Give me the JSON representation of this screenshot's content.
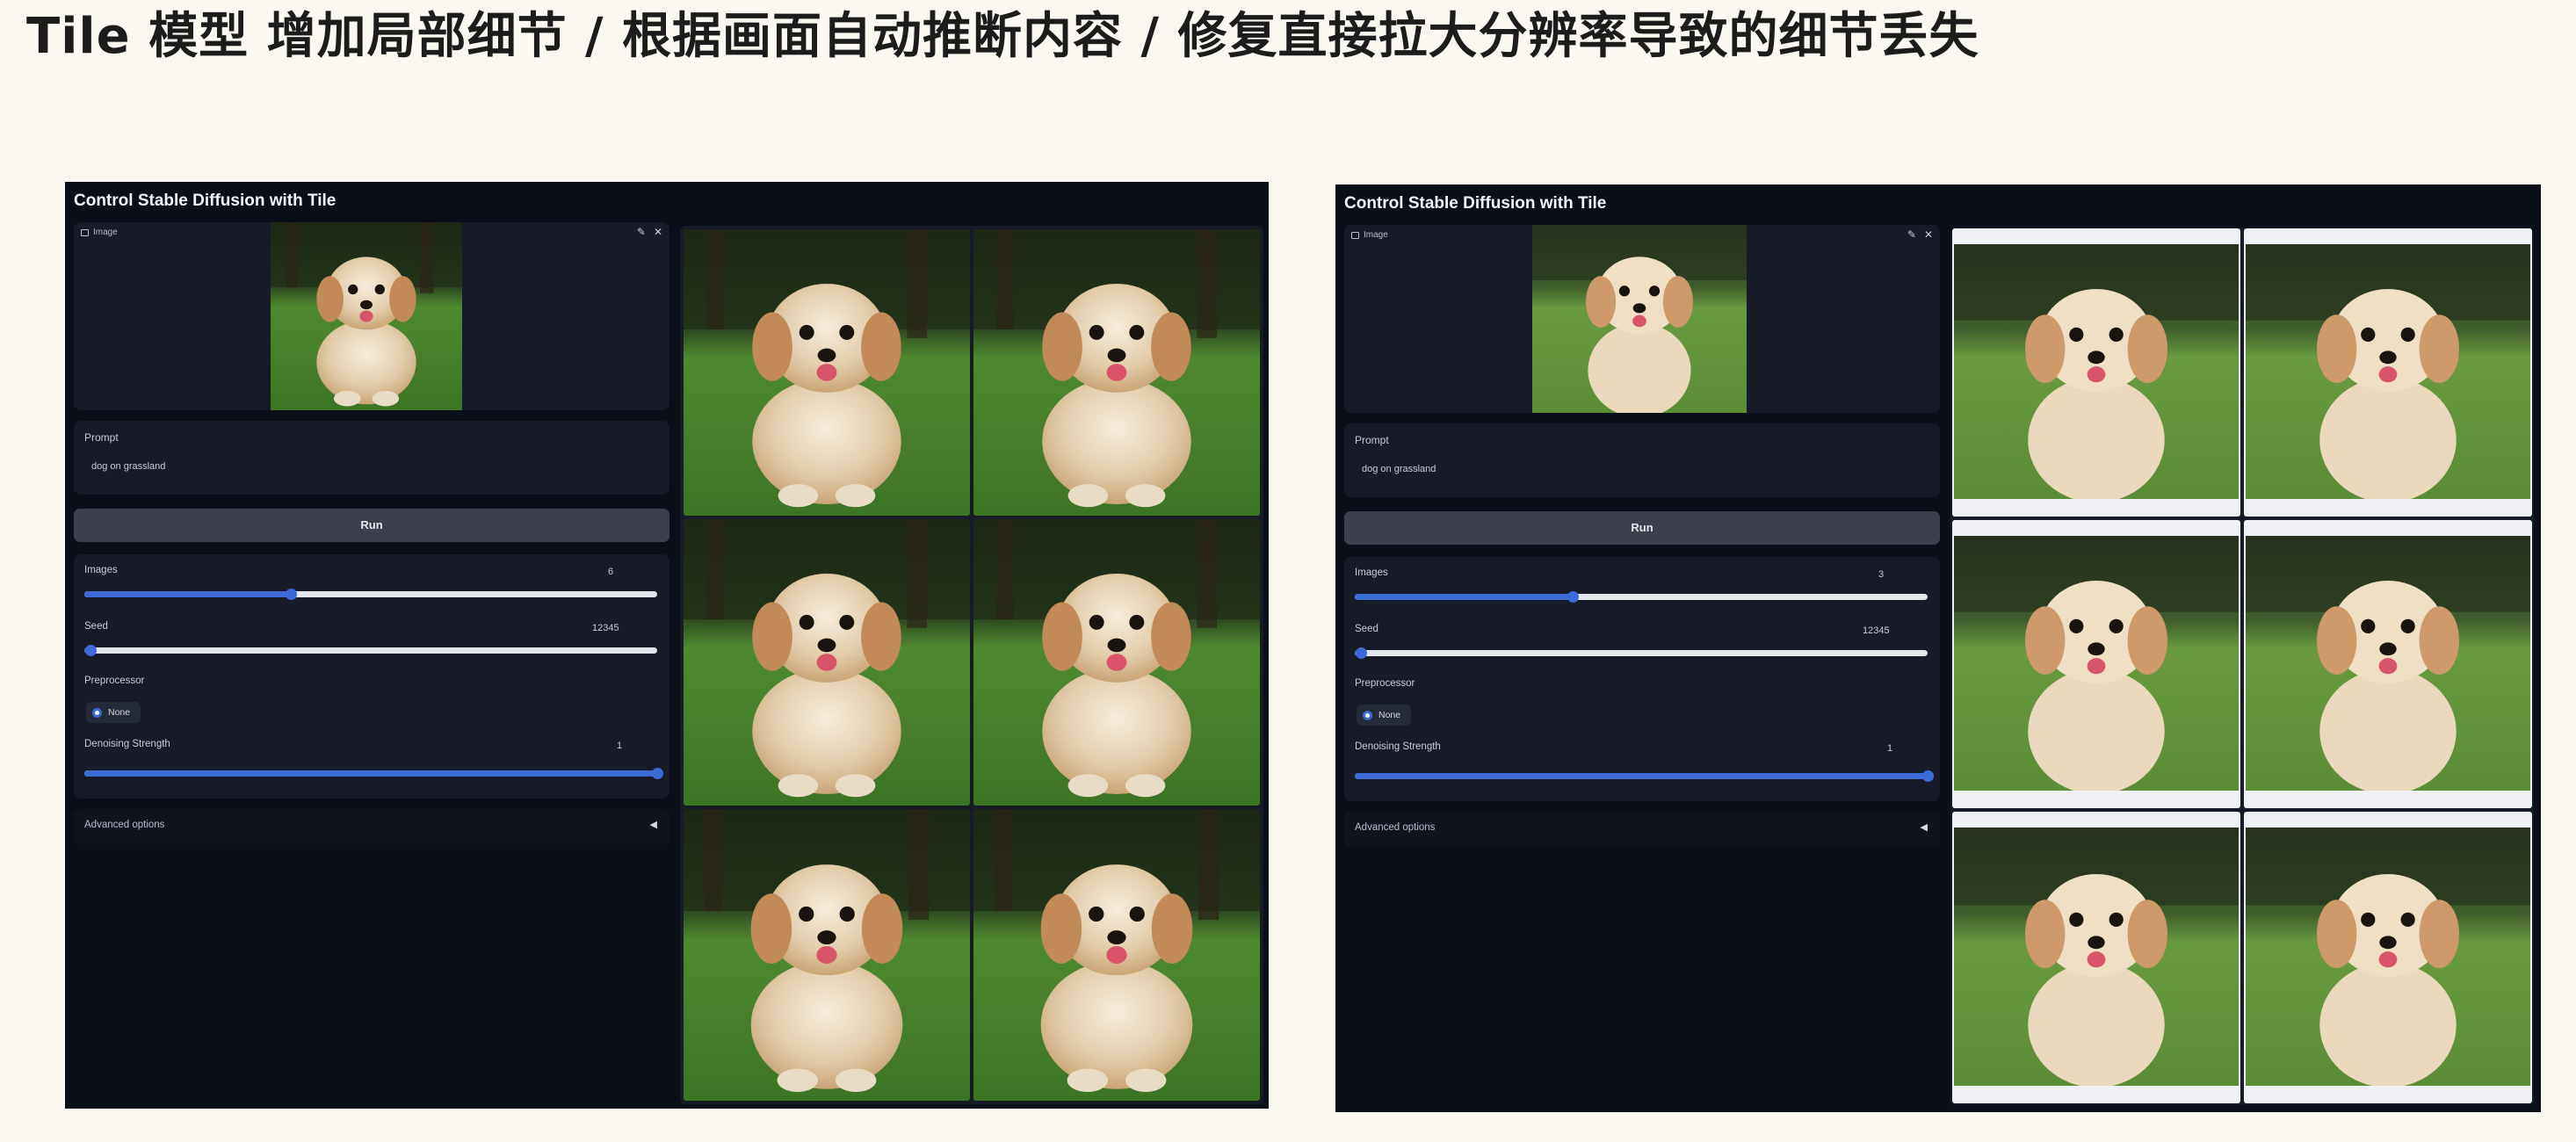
{
  "slide_title": "Tile 模型 增加局部细节 / 根据画面自动推断内容 / 修复直接拉大分辨率导致的细节丢失",
  "colors": {
    "page_bg": "#fbf8f2",
    "app_bg": "#0b0f1a",
    "panel_bg": "#161b27",
    "accent_blue": "#3b6ad6",
    "run_button_bg": "#3b404c",
    "image_frame": "#eef0f3"
  },
  "apps": [
    {
      "title": "Control Stable Diffusion with Tile",
      "image_label": "Image",
      "edit_icon": "pencil-icon",
      "close_icon": "close-icon",
      "prompt_label": "Prompt",
      "prompt_value": "dog on grassland",
      "run_label": "Run",
      "images_label": "Images",
      "images_value": "6",
      "images_slider_fraction": 0.36,
      "seed_label": "Seed",
      "seed_value": "12345",
      "seed_slider_fraction": 0.01,
      "preprocessor_label": "Preprocessor",
      "preprocessor_option": "None",
      "denoise_label": "Denoising Strength",
      "denoise_value": "1",
      "denoise_slider_fraction": 1.0,
      "advanced_label": "Advanced options",
      "advanced_icon": "triangle-left-icon",
      "gallery_count": 6
    },
    {
      "title": "Control Stable Diffusion with Tile",
      "image_label": "Image",
      "edit_icon": "pencil-icon",
      "close_icon": "close-icon",
      "prompt_label": "Prompt",
      "prompt_value": "dog on grassland",
      "run_label": "Run",
      "images_label": "Images",
      "images_value": "3",
      "images_slider_fraction": 0.38,
      "seed_label": "Seed",
      "seed_value": "12345",
      "seed_slider_fraction": 0.01,
      "preprocessor_label": "Preprocessor",
      "preprocessor_option": "None",
      "denoise_label": "Denoising Strength",
      "denoise_value": "1",
      "denoise_slider_fraction": 1.0,
      "advanced_label": "Advanced options",
      "advanced_icon": "triangle-left-icon",
      "gallery_count": 6
    }
  ]
}
